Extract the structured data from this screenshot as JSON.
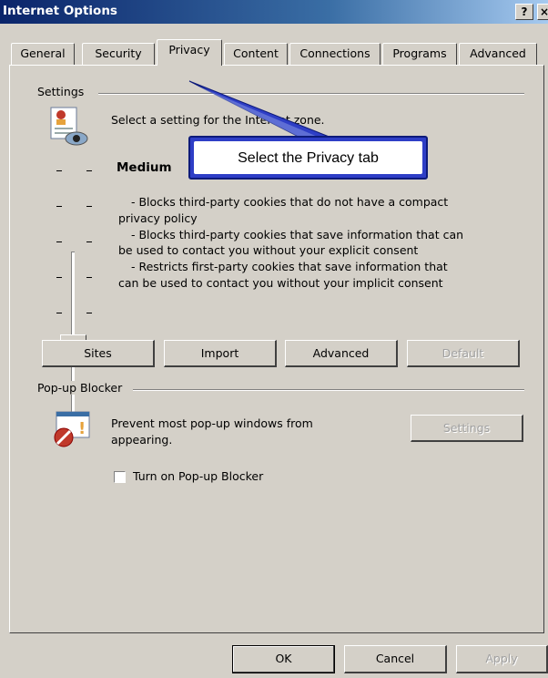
{
  "window": {
    "title": "Internet Options",
    "help_glyph": "?",
    "close_glyph": "×"
  },
  "tabs": [
    {
      "label": "General"
    },
    {
      "label": "Security"
    },
    {
      "label": "Privacy"
    },
    {
      "label": "Content"
    },
    {
      "label": "Connections"
    },
    {
      "label": "Programs"
    },
    {
      "label": "Advanced"
    }
  ],
  "settings": {
    "group_label": "Settings",
    "zone_text": "Select a setting for the Internet zone.",
    "level": "Medium",
    "descriptions": [
      "- Blocks third-party cookies that do not have a compact",
      "privacy policy",
      "- Blocks third-party cookies that save information that can",
      "be used to contact you without your explicit consent",
      "- Restricts first-party cookies that save information that",
      "can be used to contact you without your implicit consent"
    ],
    "buttons": {
      "sites": "Sites",
      "import": "Import",
      "advanced": "Advanced",
      "default": "Default"
    },
    "slider_level_fraction": 0.5
  },
  "popup": {
    "group_label": "Pop-up Blocker",
    "text_line1": "Prevent most pop-up windows from",
    "text_line2": "appearing.",
    "settings_button": "Settings",
    "checkbox_label": "Turn on Pop-up Blocker",
    "checked": false
  },
  "footer": {
    "ok": "OK",
    "cancel": "Cancel",
    "apply": "Apply"
  },
  "callout": {
    "text": "Select the Privacy tab"
  },
  "colors": {
    "title_blue": "#0a246a",
    "callout_border": "#2e3ec6",
    "dialog_bg": "#d4d0c8"
  }
}
